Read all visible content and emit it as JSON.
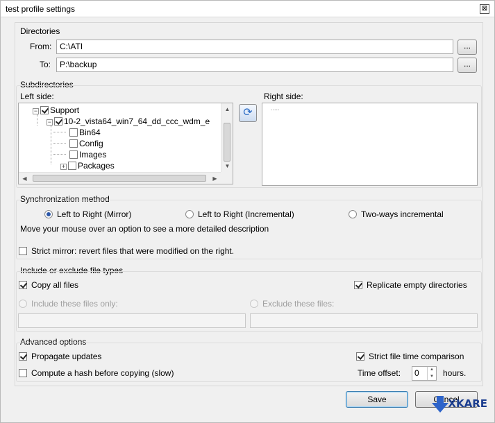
{
  "window": {
    "title": "test profile settings",
    "close_glyph": "⊠"
  },
  "directories": {
    "title": "Directories",
    "from_label": "From:",
    "from_value": "C:\\ATI",
    "to_label": "To:",
    "to_value": "P:\\backup",
    "browse_label": "..."
  },
  "subdirectories": {
    "title": "Subdirectories",
    "left_label": "Left side:",
    "right_label": "Right side:",
    "tree": [
      {
        "label": "Support",
        "checked": true,
        "expander": "−"
      },
      {
        "label": "10-2_vista64_win7_64_dd_ccc_wdm_e",
        "checked": true,
        "expander": "−"
      },
      {
        "label": "Bin64",
        "checked": false
      },
      {
        "label": "Config",
        "checked": false
      },
      {
        "label": "Images",
        "checked": false
      },
      {
        "label": "Packages",
        "checked": false,
        "expander": "+"
      }
    ],
    "right_tree_placeholder": "....."
  },
  "sync": {
    "title": "Synchronization method",
    "options": [
      {
        "label": "Left to Right (Mirror)",
        "selected": true
      },
      {
        "label": "Left to Right (Incremental)",
        "selected": false
      },
      {
        "label": "Two-ways incremental",
        "selected": false
      }
    ],
    "hint": "Move your mouse over an option to see a more detailed description",
    "strict_mirror": "Strict mirror: revert files that were modified on the right."
  },
  "filetypes": {
    "title": "Include or exclude file types",
    "copy_all": "Copy all files",
    "replicate_empty": "Replicate empty directories",
    "include_only": "Include these files only:",
    "exclude": "Exclude these files:"
  },
  "advanced": {
    "title": "Advanced options",
    "propagate": "Propagate updates",
    "strict_time": "Strict file time comparison",
    "hash": "Compute a hash before copying (slow)",
    "time_offset_label": "Time offset:",
    "time_offset_value": "0",
    "hours_label": "hours."
  },
  "buttons": {
    "save": "Save",
    "cancel": "Cancel"
  },
  "watermark": {
    "text": "XKARE"
  },
  "colors": {
    "accent": "#2a56a8",
    "default_button_border": "#3c7fb1"
  }
}
